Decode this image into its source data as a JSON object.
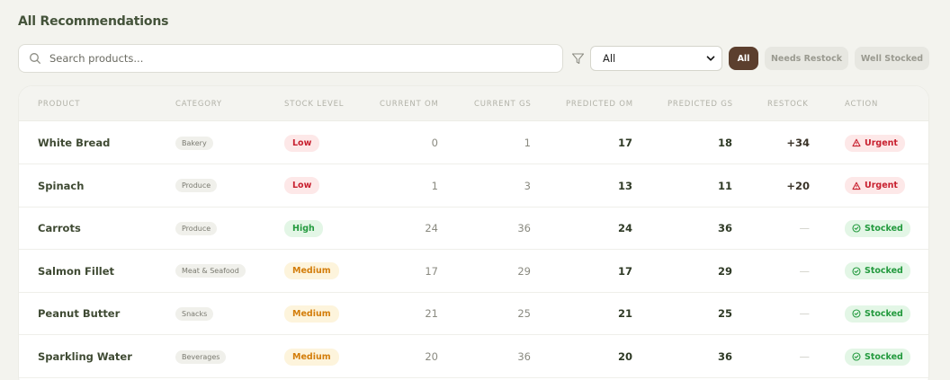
{
  "header": {
    "title": "All Recommendations"
  },
  "search": {
    "placeholder": "Search products...",
    "value": ""
  },
  "filter": {
    "selected": "All"
  },
  "pills": [
    {
      "label": "All",
      "active": true
    },
    {
      "label": "Needs Restock",
      "active": false
    },
    {
      "label": "Well Stocked",
      "active": false
    }
  ],
  "table": {
    "columns": [
      "PRODUCT",
      "CATEGORY",
      "STOCK LEVEL",
      "CURRENT OM",
      "CURRENT GS",
      "PREDICTED OM",
      "PREDICTED GS",
      "RESTOCK",
      "ACTION"
    ],
    "rows": [
      {
        "product": "White Bread",
        "category": "Bakery",
        "stock": "Low",
        "current_om": "0",
        "current_gs": "1",
        "predicted_om": "17",
        "predicted_gs": "18",
        "restock": "+34",
        "action": "Urgent"
      },
      {
        "product": "Spinach",
        "category": "Produce",
        "stock": "Low",
        "current_om": "1",
        "current_gs": "3",
        "predicted_om": "13",
        "predicted_gs": "11",
        "restock": "+20",
        "action": "Urgent"
      },
      {
        "product": "Carrots",
        "category": "Produce",
        "stock": "High",
        "current_om": "24",
        "current_gs": "36",
        "predicted_om": "24",
        "predicted_gs": "36",
        "restock": "—",
        "action": "Stocked"
      },
      {
        "product": "Salmon Fillet",
        "category": "Meat & Seafood",
        "stock": "Medium",
        "current_om": "17",
        "current_gs": "29",
        "predicted_om": "17",
        "predicted_gs": "29",
        "restock": "—",
        "action": "Stocked"
      },
      {
        "product": "Peanut Butter",
        "category": "Snacks",
        "stock": "Medium",
        "current_om": "21",
        "current_gs": "25",
        "predicted_om": "21",
        "predicted_gs": "25",
        "restock": "—",
        "action": "Stocked"
      },
      {
        "product": "Sparkling Water",
        "category": "Beverages",
        "stock": "Medium",
        "current_om": "20",
        "current_gs": "36",
        "predicted_om": "20",
        "predicted_gs": "36",
        "restock": "—",
        "action": "Stocked"
      }
    ]
  },
  "colors": {
    "background": "#f3f3ee",
    "accent": "#5c3f2e",
    "low": "#c8202f",
    "high": "#239a3e",
    "medium": "#d37d0a"
  },
  "icons": {
    "search": "search-icon",
    "filter": "filter-icon",
    "chevron": "chevron-down-icon",
    "urgent": "alert-triangle-icon",
    "stocked": "check-circle-icon"
  }
}
